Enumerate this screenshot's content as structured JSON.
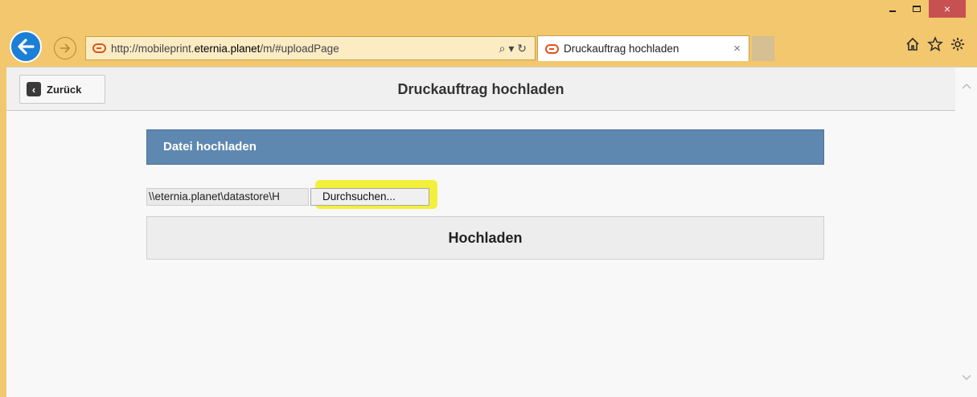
{
  "browser": {
    "address_prefix": "http://mobileprint.",
    "address_domain": "eternia.planet",
    "address_suffix": "/m/#uploadPage",
    "address_tools": "⌕ ▾ ↻",
    "tab_title": "Druckauftrag hochladen",
    "tab_close": "×",
    "window_close": "×",
    "toolbar_icons": [
      "home-icon",
      "favorites-star-icon",
      "settings-gear-icon"
    ]
  },
  "page": {
    "back_label": "Zurück",
    "title": "Druckauftrag hochladen",
    "section_title": "Datei hochladen",
    "file_path_value": "\\\\eternia.planet\\datastore\\H",
    "browse_label": "Durchsuchen...",
    "upload_label": "Hochladen"
  },
  "colors": {
    "browser_frame": "#f2c76d",
    "section_header": "#5e88b0",
    "highlight": "#f2ef2a",
    "back_button_blue": "#1c7fd6"
  }
}
